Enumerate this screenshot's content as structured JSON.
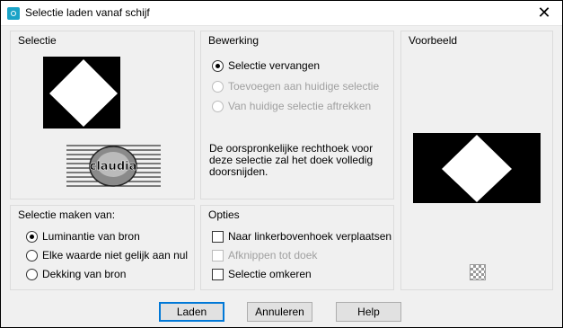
{
  "window": {
    "title": "Selectie laden vanaf schijf",
    "close_symbol": "✕"
  },
  "panels": {
    "selectie": {
      "title": "Selectie",
      "watermark": "claudia"
    },
    "bewerking": {
      "title": "Bewerking",
      "options": [
        {
          "label": "Selectie vervangen",
          "selected": true,
          "enabled": true
        },
        {
          "label": "Toevoegen aan huidige selectie",
          "selected": false,
          "enabled": false
        },
        {
          "label": "Van huidige selectie aftrekken",
          "selected": false,
          "enabled": false
        }
      ],
      "note": "De oorspronkelijke rechthoek voor deze selectie zal het doek volledig doorsnijden."
    },
    "voorbeeld": {
      "title": "Voorbeeld"
    },
    "selectie_maken": {
      "title": "Selectie maken van:",
      "options": [
        {
          "label": "Luminantie van bron",
          "selected": true
        },
        {
          "label": "Elke waarde niet gelijk aan nul",
          "selected": false
        },
        {
          "label": "Dekking van bron",
          "selected": false
        }
      ]
    },
    "opties": {
      "title": "Opties",
      "options": [
        {
          "label": "Naar linkerbovenhoek verplaatsen",
          "checked": false,
          "enabled": true
        },
        {
          "label": "Afknippen tot doek",
          "checked": false,
          "enabled": false
        },
        {
          "label": "Selectie omkeren",
          "checked": false,
          "enabled": true
        }
      ]
    }
  },
  "buttons": {
    "load": "Laden",
    "cancel": "Annuleren",
    "help": "Help"
  },
  "colors": {
    "accent": "#0078d7",
    "titlebar_icon": "#1aa3c7"
  }
}
